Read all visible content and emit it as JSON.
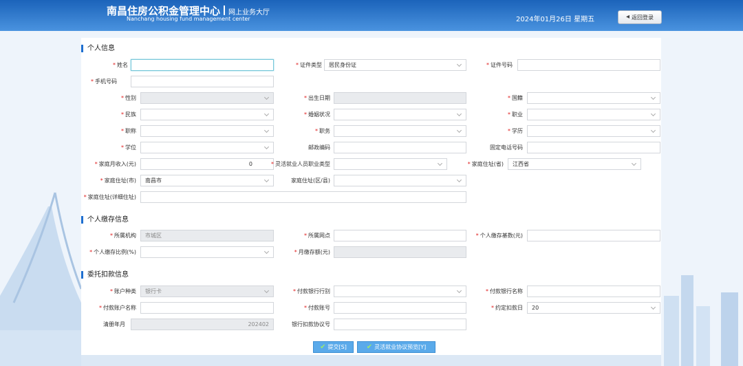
{
  "header": {
    "title": "南昌住房公积金管理中心",
    "subtitle": "网上业务大厅",
    "title_en": "Nanchang housing fund management center",
    "date": "2024年01月26日 星期五",
    "back_label": "返回登录"
  },
  "sections": {
    "personal": "个人信息",
    "deposit": "个人缴存信息",
    "debit": "委托扣款信息"
  },
  "fields": {
    "name": {
      "label": "姓名",
      "value": ""
    },
    "id_type": {
      "label": "证件类型",
      "value": "居民身份证"
    },
    "id_number": {
      "label": "证件号码",
      "value": ""
    },
    "phone": {
      "label": "手机号码",
      "value": ""
    },
    "gender": {
      "label": "性别",
      "value": ""
    },
    "birth_date": {
      "label": "出生日期",
      "value": ""
    },
    "nationality": {
      "label": "国籍",
      "value": ""
    },
    "ethnicity": {
      "label": "民族",
      "value": ""
    },
    "marital": {
      "label": "婚姻状况",
      "value": ""
    },
    "occupation": {
      "label": "职业",
      "value": ""
    },
    "title": {
      "label": "职称",
      "value": ""
    },
    "position": {
      "label": "职务",
      "value": ""
    },
    "education": {
      "label": "学历",
      "value": ""
    },
    "degree": {
      "label": "学位",
      "value": ""
    },
    "postcode": {
      "label": "邮政编码",
      "value": ""
    },
    "landline": {
      "label": "固定电话号码",
      "value": ""
    },
    "income": {
      "label": "家庭月收入(元)",
      "value": "0"
    },
    "flex_type": {
      "label": "灵活就业人员职业类型",
      "value": ""
    },
    "province": {
      "label": "家庭住址(省)",
      "value": "江西省"
    },
    "city": {
      "label": "家庭住址(市)",
      "value": "南昌市"
    },
    "district": {
      "label": "家庭住址(区/县)",
      "value": ""
    },
    "address": {
      "label": "家庭住址(详细住址)",
      "value": ""
    },
    "org": {
      "label": "所属机构",
      "value": "市城区"
    },
    "branch": {
      "label": "所属网点",
      "value": ""
    },
    "base": {
      "label": "个人缴存基数(元)",
      "value": ""
    },
    "ratio": {
      "label": "个人缴存比例(%)",
      "value": ""
    },
    "monthly": {
      "label": "月缴存额(元)",
      "value": ""
    },
    "acct_type": {
      "label": "账户种类",
      "value": "银行卡"
    },
    "bank_line": {
      "label": "付款银行行别",
      "value": ""
    },
    "bank_name": {
      "label": "付款银行名称",
      "value": ""
    },
    "acct_name": {
      "label": "付款账户名称",
      "value": ""
    },
    "acct_no": {
      "label": "付款账号",
      "value": ""
    },
    "debit_day": {
      "label": "约定扣款日",
      "value": "20"
    },
    "clear_month": {
      "label": "清册年月",
      "value": "202402"
    },
    "agreement_no": {
      "label": "银行扣款协议号",
      "value": ""
    }
  },
  "buttons": {
    "submit": "提交[S]",
    "preview": "灵活就业协议预览[Y]"
  },
  "colors": {
    "header": "#2a73c8",
    "required": "#e02020",
    "accent": "#1f6fd0",
    "button": "#5aaaea"
  }
}
